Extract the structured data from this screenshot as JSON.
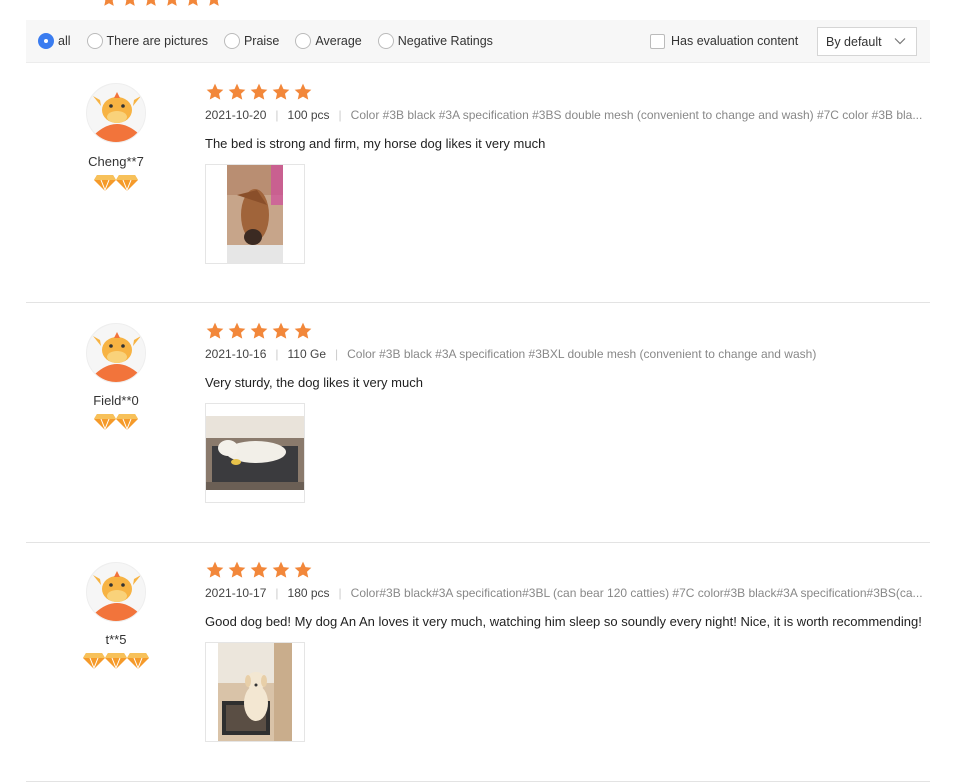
{
  "filters": {
    "options": [
      {
        "label": "all",
        "checked": true
      },
      {
        "label": "There are pictures",
        "checked": false
      },
      {
        "label": "Praise",
        "checked": false
      },
      {
        "label": "Average",
        "checked": false
      },
      {
        "label": "Negative Ratings",
        "checked": false
      }
    ],
    "has_content_label": "Has evaluation content",
    "sort_value": "By default"
  },
  "colors": {
    "star": "#f2873a",
    "badge": "#f59a2a",
    "accent": "#3a7cf0"
  },
  "reviews": [
    {
      "username": "Cheng**7",
      "rating": 5,
      "badges": 2,
      "date": "2021-10-20",
      "qty": "100 pcs",
      "spec": "Color #3B black #3A specification #3BS double mesh (convenient to change and wash) #7C color #3B bla...",
      "text": "The bed is strong and firm, my horse dog likes it very much",
      "photo_icon": "dog-lying-photo"
    },
    {
      "username": "Field**0",
      "rating": 5,
      "badges": 2,
      "date": "2021-10-16",
      "qty": "110 Ge",
      "spec": "Color #3B black #3A specification #3BXL double mesh (convenient to change and wash)",
      "text": "Very sturdy, the dog likes it very much",
      "photo_icon": "dog-on-bed-photo"
    },
    {
      "username": "t**5",
      "rating": 5,
      "badges": 3,
      "date": "2021-10-17",
      "qty": "180 pcs",
      "spec": "Color#3B black#3A specification#3BL (can bear 120 catties) #7C color#3B black#3A specification#3BS(ca...",
      "text": "Good dog bed! My dog An An loves it very much, watching him sleep so soundly every night! Nice, it is worth recommending!",
      "photo_icon": "puppy-sitting-photo"
    }
  ]
}
